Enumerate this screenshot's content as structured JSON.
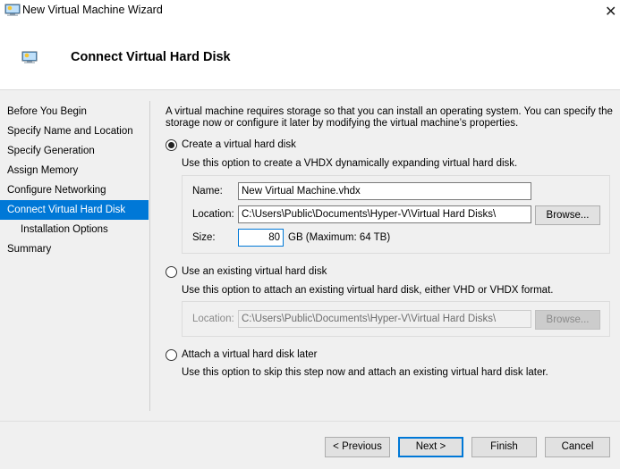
{
  "window": {
    "title": "New Virtual Machine Wizard",
    "close_glyph": "✕",
    "icon": "virtual-machine-icon"
  },
  "header": {
    "title": "Connect Virtual Hard Disk",
    "icon": "virtual-machine-icon"
  },
  "nav": {
    "items": [
      {
        "label": "Before You Begin",
        "active": false,
        "sub": false
      },
      {
        "label": "Specify Name and Location",
        "active": false,
        "sub": false
      },
      {
        "label": "Specify Generation",
        "active": false,
        "sub": false
      },
      {
        "label": "Assign Memory",
        "active": false,
        "sub": false
      },
      {
        "label": "Configure Networking",
        "active": false,
        "sub": false
      },
      {
        "label": "Connect Virtual Hard Disk",
        "active": true,
        "sub": false
      },
      {
        "label": "Installation Options",
        "active": false,
        "sub": true
      },
      {
        "label": "Summary",
        "active": false,
        "sub": false
      }
    ]
  },
  "main": {
    "intro_line1": "A virtual machine requires storage so that you can install an operating system. You can specify the",
    "intro_line2": "storage now or configure it later by modifying the virtual machine’s properties.",
    "option_create": {
      "label": "Create a virtual hard disk",
      "selected": true,
      "description": "Use this option to create a VHDX dynamically expanding virtual hard disk.",
      "name_label": "Name:",
      "name_value": "New Virtual Machine.vhdx",
      "location_label": "Location:",
      "location_value": "C:\\Users\\Public\\Documents\\Hyper-V\\Virtual Hard Disks\\",
      "browse_label": "Browse...",
      "size_label": "Size:",
      "size_value": "80",
      "size_suffix": "GB (Maximum: 64 TB)"
    },
    "option_existing": {
      "label": "Use an existing virtual hard disk",
      "selected": false,
      "description": "Use this option to attach an existing virtual hard disk, either VHD or VHDX format.",
      "location_label": "Location:",
      "location_value": "C:\\Users\\Public\\Documents\\Hyper-V\\Virtual Hard Disks\\",
      "browse_label": "Browse..."
    },
    "option_later": {
      "label": "Attach a virtual hard disk later",
      "selected": false,
      "description": "Use this option to skip this step now and attach an existing virtual hard disk later."
    }
  },
  "footer": {
    "previous_label": "< Previous",
    "next_label": "Next >",
    "finish_label": "Finish",
    "cancel_label": "Cancel"
  }
}
